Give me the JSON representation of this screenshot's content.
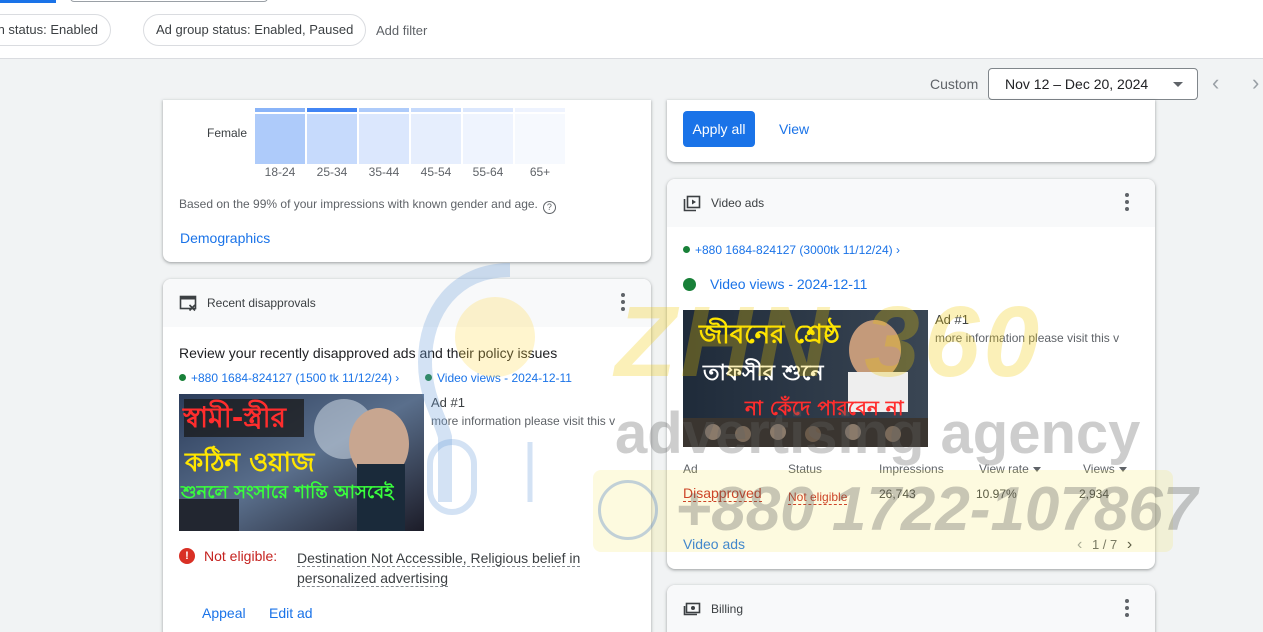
{
  "filters": {
    "campaign_status": "paign status: Enabled",
    "ad_group_status": "Ad group status: Enabled, Paused",
    "add_filter": "Add filter"
  },
  "date": {
    "label": "Custom",
    "range": "Nov 12 – Dec 20, 2024"
  },
  "demographics": {
    "row_label": "Female",
    "age_groups": [
      "18-24",
      "25-34",
      "35-44",
      "45-54",
      "55-64",
      "65+"
    ],
    "note": "Based on the 99% of your impressions with known gender and age.",
    "link": "Demographics"
  },
  "recommendations": {
    "apply_all": "Apply all",
    "view": "View"
  },
  "disapprovals": {
    "title": "Recent disapprovals",
    "headline": "Review your recently disapproved ads and their policy issues",
    "campaign": "+880 1684-824127 (1500 tk 11/12/24) ›",
    "ad_group": "Video views - 2024-12-11",
    "ad_number": "Ad #1",
    "ad_description": "more information please visit this v",
    "thumbnail_text": [
      "স্বামী-স্ত্রীর",
      "কঠিন ওয়াজ",
      "শুনলে সংসারে শান্তি আসবেই"
    ],
    "status": "Not eligible:",
    "reason": "Destination Not Accessible, Religious belief in personalized advertising",
    "appeal": "Appeal",
    "edit_ad": "Edit ad"
  },
  "video_ads": {
    "title": "Video ads",
    "campaign": "+880 1684-824127 (3000tk 11/12/24) ›",
    "ad_group": "Video views - 2024-12-11",
    "ad_number": "Ad #1",
    "ad_description": "more information please visit this v",
    "thumbnail_text": [
      "জীবনের শ্রেষ্ঠ",
      "তাফসীর শুনে",
      "না কেঁদে পারবেন না"
    ],
    "columns": [
      "Ad",
      "Status",
      "Impressions",
      "View rate",
      "Views"
    ],
    "row": {
      "ad": "Disapproved",
      "status": "Not eligible",
      "impressions": "26,743",
      "view_rate": "10.97%",
      "views": "2,934"
    },
    "link": "Video ads",
    "pager": "1 / 7"
  },
  "billing": {
    "title": "Billing"
  },
  "watermark": {
    "brand": "ZHN 360",
    "tagline": "advertising agency",
    "phone": "+880 1722-107867"
  },
  "colors": {
    "accent": "#1a73e8",
    "error": "#c5221f",
    "enabled": "#188038"
  },
  "icons": [
    "help-icon",
    "disapproval-icon",
    "video-icon",
    "billing-icon",
    "more-vert-icon",
    "dropdown-icon",
    "chevron-left-icon",
    "chevron-right-icon",
    "error-icon"
  ]
}
